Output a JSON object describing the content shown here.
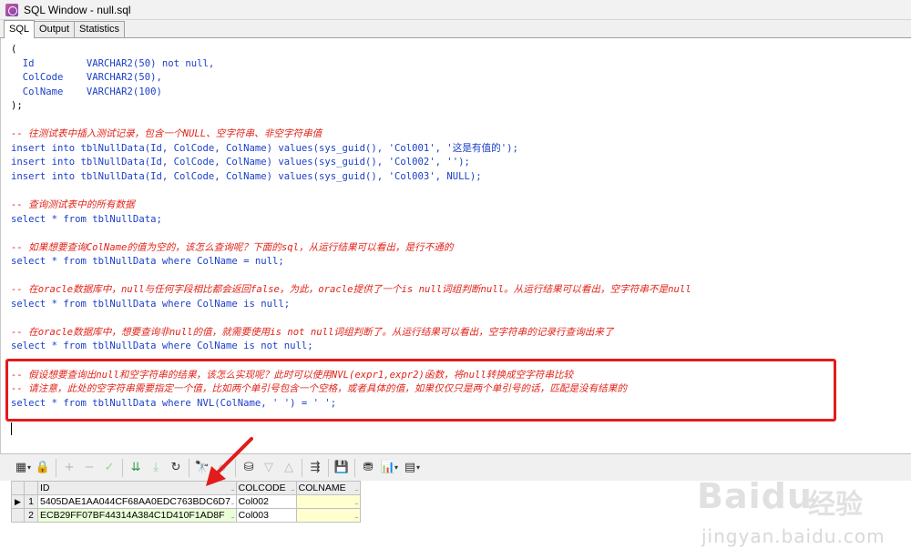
{
  "window": {
    "title": "SQL Window - null.sql"
  },
  "tabs": [
    {
      "label": "SQL",
      "active": true
    },
    {
      "label": "Output",
      "active": false
    },
    {
      "label": "Statistics",
      "active": false
    }
  ],
  "editor": {
    "lines": [
      [
        {
          "t": "(",
          "c": "black"
        }
      ],
      [
        {
          "t": "  Id         VARCHAR2(50) not null,",
          "c": "kw"
        }
      ],
      [
        {
          "t": "  ColCode    VARCHAR2(50),",
          "c": "kw"
        }
      ],
      [
        {
          "t": "  ColName    VARCHAR2(100)",
          "c": "kw"
        }
      ],
      [
        {
          "t": ");",
          "c": "black"
        }
      ],
      [
        {
          "t": "",
          "c": "black"
        }
      ],
      [
        {
          "t": "-- 往测试表中插入测试记录，包含一个NULL、空字符串、非空字符串值",
          "c": "com"
        }
      ],
      [
        {
          "t": "insert into tblNullData(Id, ColCode, ColName) values(sys_guid(), 'Col001', '这是有值的');",
          "c": "kw"
        }
      ],
      [
        {
          "t": "insert into tblNullData(Id, ColCode, ColName) values(sys_guid(), 'Col002', '');",
          "c": "kw"
        }
      ],
      [
        {
          "t": "insert into tblNullData(Id, ColCode, ColName) values(sys_guid(), 'Col003', NULL);",
          "c": "kw"
        }
      ],
      [
        {
          "t": "",
          "c": "black"
        }
      ],
      [
        {
          "t": "-- 查询测试表中的所有数据",
          "c": "com"
        }
      ],
      [
        {
          "t": "select * from tblNullData;",
          "c": "kw"
        }
      ],
      [
        {
          "t": "",
          "c": "black"
        }
      ],
      [
        {
          "t": "-- 如果想要查询ColName的值为空的，该怎么查询呢？下面的sql，从运行结果可以看出，是行不通的",
          "c": "com"
        }
      ],
      [
        {
          "t": "select * from tblNullData where ColName = null;",
          "c": "kw"
        }
      ],
      [
        {
          "t": "",
          "c": "black"
        }
      ],
      [
        {
          "t": "-- 在oracle数据库中，null与任何字段相比都会返回false，为此，oracle提供了一个is null词组判断null。从运行结果可以看出，空字符串不是null",
          "c": "com"
        }
      ],
      [
        {
          "t": "select * from tblNullData where ColName is null;",
          "c": "kw"
        }
      ],
      [
        {
          "t": "",
          "c": "black"
        }
      ],
      [
        {
          "t": "-- 在oracle数据库中，想要查询非null的值，就需要使用is not null词组判断了。从运行结果可以看出，空字符串的记录行查询出来了",
          "c": "com"
        }
      ],
      [
        {
          "t": "select * from tblNullData where ColName is not null;",
          "c": "kw"
        }
      ],
      [
        {
          "t": "",
          "c": "black"
        }
      ],
      [
        {
          "t": "-- 假设想要查询出null和空字符串的结果，该怎么实现呢？此时可以使用NVL(expr1,expr2)函数，将null转换成空字符串比较",
          "c": "com"
        }
      ],
      [
        {
          "t": "-- 请注意，此处的空字符串需要指定一个值，比如两个单引号包含一个空格，或者具体的值，如果仅仅只是两个单引号的话，匹配是没有结果的",
          "c": "com"
        }
      ],
      [
        {
          "t": "select * from tblNullData where NVL(ColName, ' ') = ' ';",
          "c": "kw"
        }
      ]
    ]
  },
  "toolbar": {
    "buttons": [
      {
        "name": "grid-icon",
        "glyph": "▦",
        "style": ""
      },
      {
        "name": "lock-icon",
        "glyph": "🔒",
        "style": ""
      },
      {
        "name": "add-icon",
        "glyph": "+",
        "style": "dim"
      },
      {
        "name": "remove-icon",
        "glyph": "−",
        "style": "dim"
      },
      {
        "name": "post-icon",
        "glyph": "✓",
        "style": "dimgreen"
      },
      {
        "name": "fetch-next-icon",
        "glyph": "⇊",
        "style": "green"
      },
      {
        "name": "fetch-last-icon",
        "glyph": "⤓",
        "style": "dimgreen"
      },
      {
        "name": "refresh-icon",
        "glyph": "↻",
        "style": ""
      },
      {
        "name": "find-icon",
        "glyph": "🔭",
        "style": ""
      },
      {
        "name": "clear-icon",
        "glyph": "⌀",
        "style": "dim"
      },
      {
        "name": "query-by-example-icon",
        "glyph": "⛁",
        "style": ""
      },
      {
        "name": "next-record-icon",
        "glyph": "▽",
        "style": "dim"
      },
      {
        "name": "prev-record-icon",
        "glyph": "△",
        "style": "dim"
      },
      {
        "name": "link-icon",
        "glyph": "⇶",
        "style": ""
      },
      {
        "name": "save-icon",
        "glyph": "💾",
        "style": ""
      },
      {
        "name": "export-icon",
        "glyph": "⛃",
        "style": ""
      },
      {
        "name": "chart-icon",
        "glyph": "📊",
        "style": ""
      },
      {
        "name": "table-icon",
        "glyph": "▤",
        "style": ""
      }
    ]
  },
  "results": {
    "columns": [
      "ID",
      "COLCODE",
      "COLNAME"
    ],
    "rows": [
      {
        "num": "1",
        "id": "5405DAE1AA044CF68AA0EDC763BDC6D7",
        "colcode": "Col002",
        "colname": ""
      },
      {
        "num": "2",
        "id": "ECB29FF07BF44314A384C1D410F1AD8F",
        "colcode": "Col003",
        "colname": ""
      }
    ],
    "ellipsis": "..."
  },
  "watermark": {
    "logo": "Baidu",
    "cn": "经验",
    "url": "jingyan.baidu.com"
  },
  "colors": {
    "comment": "#e2231a",
    "keyword": "#1a3fc8",
    "highlight_border": "#e21b1b"
  }
}
